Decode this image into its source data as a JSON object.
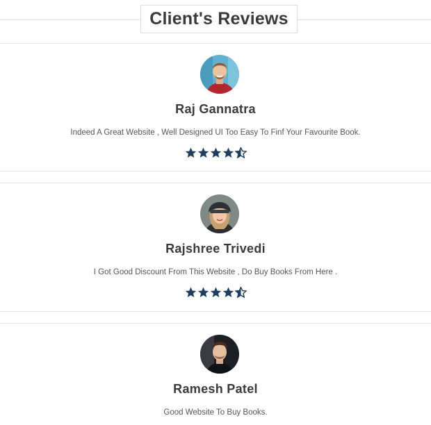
{
  "section": {
    "title": "Client's Reviews"
  },
  "colors": {
    "star": "#1f3e5f",
    "text": "#333333",
    "divider": "#e2e2e2"
  },
  "reviews": [
    {
      "name": "Raj Gannatra",
      "text": "Indeed A Great Website , Well Designed UI Too Easy To Finf Your Favourite Book.",
      "rating": 4.5,
      "avatar": "man-smiling-photo"
    },
    {
      "name": "Rajshree Trivedi",
      "text": "I Got Good Discount From This Website , Do Buy Books From Here .",
      "rating": 4.5,
      "avatar": "woman-beanie-photo"
    },
    {
      "name": "Ramesh Patel",
      "text": "Good Website To Buy Books.",
      "avatar": "man-portrait-photo"
    }
  ]
}
